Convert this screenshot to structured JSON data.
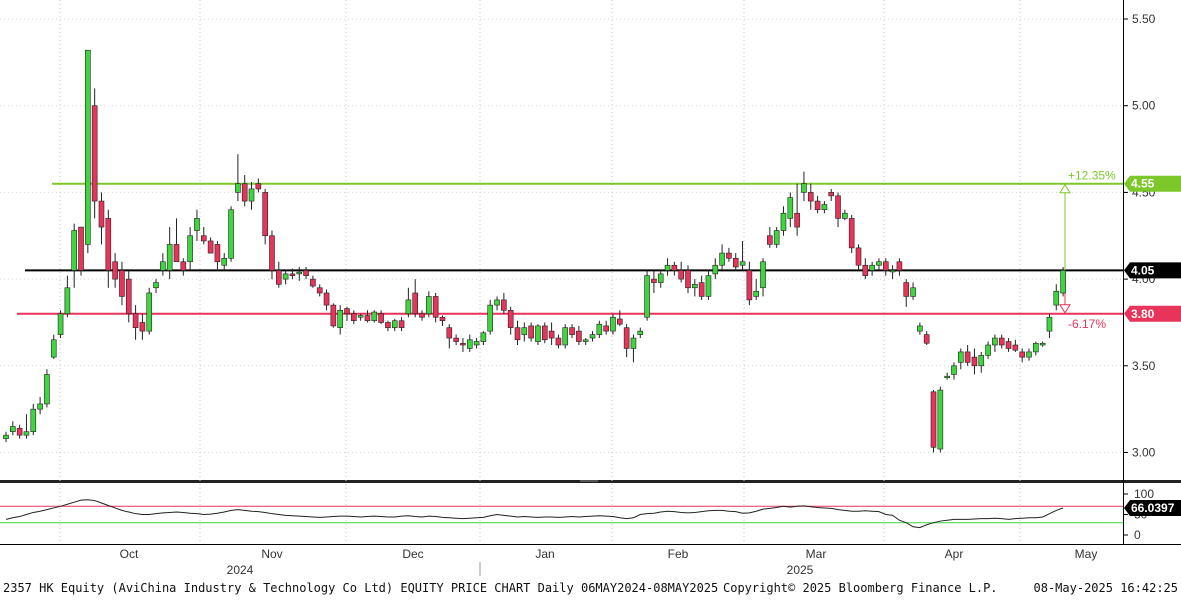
{
  "chart_data": [
    {
      "type": "candlestick",
      "title": "",
      "y_ticks": [
        3.0,
        3.5,
        4.0,
        4.5,
        5.0,
        5.5
      ],
      "y_tick_labels": [
        "3.00",
        "3.50",
        "4.00",
        "4.50",
        "5.00",
        "5.50"
      ],
      "ylim": [
        2.84,
        5.6
      ],
      "month_labels": [
        "Oct",
        "Nov",
        "Dec",
        "Jan",
        "Feb",
        "Mar",
        "Apr",
        "May"
      ],
      "year_labels": [
        "2024",
        "2025"
      ],
      "horizontal_lines": [
        {
          "name": "upper",
          "value": 4.55,
          "tag": "4.55",
          "color": "#7cc82a",
          "pct": "+12.35%"
        },
        {
          "name": "last",
          "value": 4.05,
          "tag": "4.05",
          "color": "#000000"
        },
        {
          "name": "lower",
          "value": 3.8,
          "tag": "3.80",
          "color": "#e8345a",
          "pct": "-6.17%"
        }
      ],
      "up_color": "#3fd53f",
      "down_color": "#e8345a",
      "candles": [
        [
          3.08,
          3.12,
          3.06,
          3.1
        ],
        [
          3.12,
          3.18,
          3.1,
          3.15
        ],
        [
          3.14,
          3.16,
          3.08,
          3.1
        ],
        [
          3.1,
          3.22,
          3.08,
          3.12
        ],
        [
          3.12,
          3.28,
          3.1,
          3.25
        ],
        [
          3.25,
          3.32,
          3.22,
          3.28
        ],
        [
          3.28,
          3.48,
          3.26,
          3.45
        ],
        [
          3.55,
          3.68,
          3.54,
          3.65
        ],
        [
          3.68,
          3.82,
          3.66,
          3.8
        ],
        [
          3.8,
          4.02,
          3.78,
          3.95
        ],
        [
          4.05,
          4.32,
          3.95,
          4.28
        ],
        [
          4.3,
          4.28,
          4.02,
          4.05
        ],
        [
          4.2,
          5.32,
          4.15,
          5.32
        ],
        [
          5.0,
          5.1,
          4.35,
          4.45
        ],
        [
          4.45,
          4.5,
          4.2,
          4.3
        ],
        [
          4.35,
          4.4,
          3.95,
          4.05
        ],
        [
          4.1,
          4.15,
          3.95,
          4.0
        ],
        [
          4.05,
          4.1,
          3.85,
          3.9
        ],
        [
          4.0,
          4.05,
          3.75,
          3.8
        ],
        [
          3.8,
          3.85,
          3.65,
          3.72
        ],
        [
          3.75,
          3.8,
          3.65,
          3.7
        ],
        [
          3.7,
          3.95,
          3.68,
          3.92
        ],
        [
          3.95,
          4.0,
          3.92,
          3.98
        ],
        [
          4.05,
          4.15,
          4.02,
          4.1
        ],
        [
          4.05,
          4.3,
          4.0,
          4.2
        ],
        [
          4.2,
          4.35,
          4.15,
          4.1
        ],
        [
          4.1,
          4.12,
          4.02,
          4.05
        ],
        [
          4.1,
          4.3,
          4.05,
          4.25
        ],
        [
          4.28,
          4.4,
          4.22,
          4.35
        ],
        [
          4.25,
          4.3,
          4.2,
          4.22
        ],
        [
          4.22,
          4.24,
          4.15,
          4.15
        ],
        [
          4.2,
          4.22,
          4.05,
          4.1
        ],
        [
          4.08,
          4.15,
          4.05,
          4.12
        ],
        [
          4.12,
          4.42,
          4.1,
          4.4
        ],
        [
          4.5,
          4.72,
          4.45,
          4.55
        ],
        [
          4.55,
          4.6,
          4.42,
          4.45
        ],
        [
          4.45,
          4.56,
          4.4,
          4.52
        ],
        [
          4.55,
          4.58,
          4.5,
          4.52
        ],
        [
          4.5,
          4.52,
          4.2,
          4.25
        ],
        [
          4.25,
          4.28,
          4.0,
          4.05
        ],
        [
          4.05,
          4.1,
          3.95,
          3.97
        ],
        [
          4.0,
          4.05,
          3.97,
          4.03
        ],
        [
          4.03,
          4.06,
          4.0,
          4.02
        ],
        [
          4.03,
          4.07,
          3.99,
          4.04
        ],
        [
          4.05,
          4.07,
          4.0,
          4.02
        ],
        [
          4.0,
          4.02,
          3.95,
          3.96
        ],
        [
          3.95,
          3.97,
          3.9,
          3.92
        ],
        [
          3.92,
          3.94,
          3.82,
          3.85
        ],
        [
          3.85,
          3.86,
          3.72,
          3.73
        ],
        [
          3.72,
          3.85,
          3.68,
          3.82
        ],
        [
          3.83,
          3.84,
          3.76,
          3.8
        ],
        [
          3.8,
          3.82,
          3.74,
          3.76
        ],
        [
          3.78,
          3.8,
          3.76,
          3.79
        ],
        [
          3.79,
          3.82,
          3.75,
          3.76
        ],
        [
          3.76,
          3.82,
          3.75,
          3.81
        ],
        [
          3.8,
          3.82,
          3.74,
          3.75
        ],
        [
          3.75,
          3.76,
          3.7,
          3.72
        ],
        [
          3.72,
          3.77,
          3.7,
          3.76
        ],
        [
          3.76,
          3.78,
          3.7,
          3.72
        ],
        [
          3.8,
          3.95,
          3.78,
          3.88
        ],
        [
          3.92,
          4.0,
          3.78,
          3.8
        ],
        [
          3.8,
          3.82,
          3.76,
          3.78
        ],
        [
          3.8,
          3.93,
          3.78,
          3.9
        ],
        [
          3.9,
          3.92,
          3.75,
          3.78
        ],
        [
          3.78,
          3.79,
          3.73,
          3.76
        ],
        [
          3.72,
          3.74,
          3.6,
          3.66
        ],
        [
          3.66,
          3.68,
          3.62,
          3.64
        ],
        [
          3.63,
          3.66,
          3.58,
          3.62
        ],
        [
          3.6,
          3.68,
          3.58,
          3.65
        ],
        [
          3.62,
          3.66,
          3.6,
          3.64
        ],
        [
          3.64,
          3.7,
          3.62,
          3.69
        ],
        [
          3.7,
          3.88,
          3.68,
          3.85
        ],
        [
          3.85,
          3.9,
          3.82,
          3.88
        ],
        [
          3.88,
          3.92,
          3.8,
          3.82
        ],
        [
          3.82,
          3.84,
          3.68,
          3.72
        ],
        [
          3.72,
          3.76,
          3.62,
          3.65
        ],
        [
          3.68,
          3.75,
          3.64,
          3.72
        ],
        [
          3.73,
          3.75,
          3.64,
          3.66
        ],
        [
          3.64,
          3.74,
          3.62,
          3.73
        ],
        [
          3.73,
          3.75,
          3.63,
          3.65
        ],
        [
          3.7,
          3.75,
          3.62,
          3.66
        ],
        [
          3.66,
          3.68,
          3.6,
          3.62
        ],
        [
          3.62,
          3.74,
          3.6,
          3.72
        ],
        [
          3.72,
          3.74,
          3.66,
          3.68
        ],
        [
          3.7,
          3.73,
          3.62,
          3.64
        ],
        [
          3.64,
          3.66,
          3.62,
          3.65
        ],
        [
          3.66,
          3.7,
          3.64,
          3.68
        ],
        [
          3.68,
          3.76,
          3.66,
          3.74
        ],
        [
          3.73,
          3.76,
          3.68,
          3.7
        ],
        [
          3.7,
          3.8,
          3.68,
          3.78
        ],
        [
          3.77,
          3.82,
          3.73,
          3.74
        ],
        [
          3.72,
          3.74,
          3.55,
          3.6
        ],
        [
          3.6,
          3.68,
          3.52,
          3.66
        ],
        [
          3.68,
          3.72,
          3.66,
          3.7
        ],
        [
          3.78,
          4.05,
          3.76,
          4.02
        ],
        [
          4.0,
          4.05,
          3.92,
          3.98
        ],
        [
          3.98,
          4.05,
          3.95,
          4.03
        ],
        [
          4.05,
          4.12,
          4.02,
          4.08
        ],
        [
          4.08,
          4.1,
          4.02,
          4.05
        ],
        [
          4.05,
          4.1,
          3.98,
          4.0
        ],
        [
          4.05,
          4.08,
          3.92,
          3.95
        ],
        [
          3.95,
          4.0,
          3.9,
          3.97
        ],
        [
          3.98,
          4.02,
          3.88,
          3.9
        ],
        [
          3.9,
          4.05,
          3.88,
          4.02
        ],
        [
          4.03,
          4.12,
          4.0,
          4.08
        ],
        [
          4.08,
          4.2,
          4.05,
          4.15
        ],
        [
          4.15,
          4.18,
          4.1,
          4.12
        ],
        [
          4.12,
          4.15,
          4.05,
          4.07
        ],
        [
          4.08,
          4.22,
          4.05,
          4.1
        ],
        [
          4.05,
          4.1,
          3.85,
          3.88
        ],
        [
          3.9,
          4.0,
          3.88,
          3.93
        ],
        [
          3.95,
          4.12,
          3.9,
          4.1
        ],
        [
          4.25,
          4.3,
          4.18,
          4.2
        ],
        [
          4.2,
          4.3,
          4.18,
          4.28
        ],
        [
          4.28,
          4.42,
          4.25,
          4.38
        ],
        [
          4.35,
          4.5,
          4.3,
          4.47
        ],
        [
          4.38,
          4.55,
          4.25,
          4.3
        ],
        [
          4.5,
          4.62,
          4.45,
          4.55
        ],
        [
          4.5,
          4.55,
          4.4,
          4.45
        ],
        [
          4.45,
          4.48,
          4.38,
          4.4
        ],
        [
          4.4,
          4.45,
          4.38,
          4.43
        ],
        [
          4.5,
          4.52,
          4.45,
          4.48
        ],
        [
          4.48,
          4.5,
          4.3,
          4.35
        ],
        [
          4.35,
          4.4,
          4.34,
          4.38
        ],
        [
          4.35,
          4.37,
          4.15,
          4.18
        ],
        [
          4.18,
          4.2,
          4.05,
          4.08
        ],
        [
          4.08,
          4.12,
          4.0,
          4.02
        ],
        [
          4.05,
          4.1,
          4.02,
          4.08
        ],
        [
          4.08,
          4.12,
          4.05,
          4.1
        ],
        [
          4.1,
          4.12,
          4.02,
          4.05
        ],
        [
          4.05,
          4.08,
          4.0,
          4.05
        ],
        [
          4.1,
          4.12,
          4.02,
          4.05
        ],
        [
          3.98,
          4.0,
          3.84,
          3.9
        ],
        [
          3.9,
          3.98,
          3.88,
          3.95
        ],
        [
          3.7,
          3.75,
          3.68,
          3.73
        ],
        [
          3.68,
          3.7,
          3.62,
          3.63
        ],
        [
          3.35,
          3.36,
          3.0,
          3.03
        ],
        [
          3.02,
          3.38,
          3.0,
          3.36
        ],
        [
          3.44,
          3.46,
          3.42,
          3.44
        ],
        [
          3.45,
          3.52,
          3.42,
          3.5
        ],
        [
          3.52,
          3.6,
          3.48,
          3.58
        ],
        [
          3.58,
          3.62,
          3.5,
          3.52
        ],
        [
          3.55,
          3.6,
          3.45,
          3.5
        ],
        [
          3.5,
          3.58,
          3.46,
          3.56
        ],
        [
          3.56,
          3.64,
          3.54,
          3.62
        ],
        [
          3.62,
          3.68,
          3.58,
          3.66
        ],
        [
          3.66,
          3.68,
          3.6,
          3.62
        ],
        [
          3.64,
          3.66,
          3.58,
          3.6
        ],
        [
          3.62,
          3.65,
          3.58,
          3.59
        ],
        [
          3.58,
          3.6,
          3.52,
          3.55
        ],
        [
          3.55,
          3.6,
          3.53,
          3.58
        ],
        [
          3.58,
          3.64,
          3.56,
          3.63
        ],
        [
          3.62,
          3.64,
          3.61,
          3.63
        ],
        [
          3.7,
          3.8,
          3.66,
          3.78
        ],
        [
          3.85,
          3.97,
          3.82,
          3.93
        ],
        [
          3.92,
          4.07,
          3.9,
          4.05
        ]
      ],
      "candle_index_range": [
        0,
        155
      ],
      "rsi": {
        "value_tag": "66.0397",
        "y_ticks": [
          0,
          50,
          100
        ],
        "y_tick_labels": [
          "0",
          "50",
          "100"
        ],
        "levels": [
          {
            "value": 70,
            "color": "#e8345a"
          },
          {
            "value": 30,
            "color": "#3fd53f"
          }
        ],
        "values": [
          38,
          42,
          45,
          50,
          55,
          58,
          62,
          66,
          70,
          75,
          80,
          85,
          86,
          84,
          78,
          72,
          66,
          60,
          56,
          52,
          50,
          50,
          52,
          54,
          55,
          56,
          55,
          53,
          52,
          50,
          51,
          53,
          56,
          60,
          62,
          60,
          58,
          57,
          55,
          52,
          50,
          48,
          47,
          46,
          45,
          44,
          43,
          44,
          45,
          46,
          46,
          45,
          44,
          45,
          46,
          45,
          44,
          44,
          46,
          47,
          45,
          44,
          46,
          45,
          43,
          42,
          41,
          40,
          41,
          42,
          43,
          47,
          50,
          48,
          46,
          44,
          45,
          44,
          43,
          44,
          44,
          43,
          44,
          45,
          44,
          45,
          46,
          47,
          46,
          45,
          42,
          40,
          42,
          50,
          52,
          53,
          56,
          58,
          57,
          55,
          54,
          55,
          57,
          59,
          60,
          60,
          58,
          57,
          53,
          54,
          58,
          63,
          65,
          67,
          70,
          68,
          70,
          71,
          69,
          67,
          66,
          65,
          62,
          60,
          58,
          58,
          59,
          58,
          57,
          50,
          48,
          36,
          30,
          20,
          18,
          25,
          30,
          34,
          36,
          38,
          38,
          38,
          39,
          40,
          40,
          41,
          40,
          38,
          40,
          41,
          42,
          42,
          44,
          52,
          60,
          66
        ]
      }
    }
  ],
  "footer": {
    "left": "2357 HK Equity (AviChina Industry & Technology Co Ltd) EQUITY PRICE CHART  Daily 06MAY2024-08MAY2025",
    "center": "Copyright© 2025 Bloomberg Finance L.P.",
    "right": "08-May-2025 16:42:25"
  }
}
